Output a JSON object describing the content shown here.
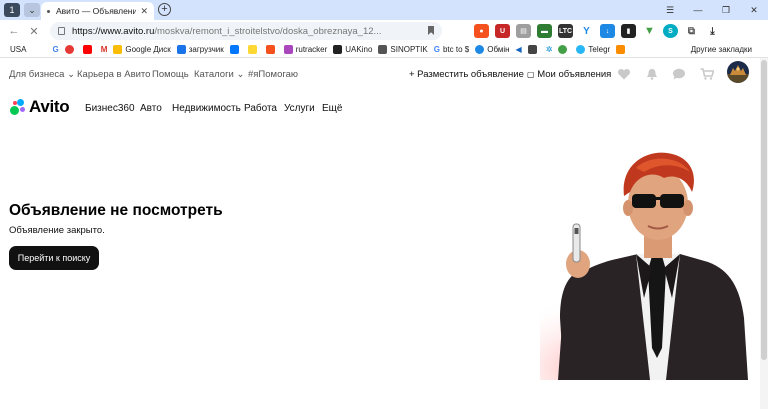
{
  "browser": {
    "tab_title": "Авито — Объявления о",
    "url_host": "https://www.avito.ru",
    "url_path": "/moskva/remont_i_stroitelstvo/doska_obreznaya_12...",
    "bookmarks": [
      "USA",
      "Google Диск",
      "загрузчик",
      "rutracker",
      "UAKino",
      "SINOPTIK",
      "btc to $",
      "Обмін",
      "Telegr"
    ],
    "bookmarks_other": "Другие закладки"
  },
  "topnav": {
    "business": "Для бизнеса",
    "career": "Карьера в Авито",
    "help": "Помощь",
    "catalogs": "Каталоги",
    "ihelp": "#яПомогаю",
    "post_ad": "+ Разместить объявление",
    "my_ads": "Мои объявления"
  },
  "logo": {
    "text": "Avito"
  },
  "mainnav": [
    "Бизнес360",
    "Авто",
    "Недвижимость",
    "Работа",
    "Услуги",
    "Ещё"
  ],
  "content": {
    "title": "Объявление не посмотреть",
    "subtitle": "Объявление закрыто.",
    "button": "Перейти к поиску"
  },
  "colors": {
    "accent_green": "#00aaff",
    "button_bg": "#111111"
  }
}
